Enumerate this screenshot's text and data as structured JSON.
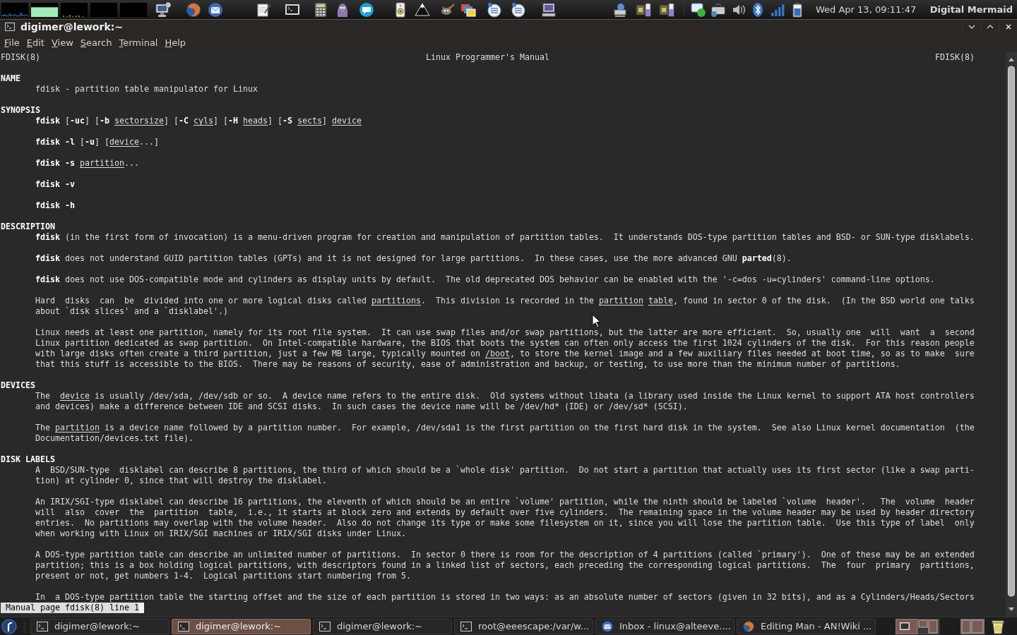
{
  "top_panel": {
    "clock": "Wed Apr 13, 09:11:47",
    "user_name": "Digital Mermaid"
  },
  "window": {
    "title": "digimer@lework:~",
    "menu": [
      "File",
      "Edit",
      "View",
      "Search",
      "Terminal",
      "Help"
    ]
  },
  "man_page": {
    "header": {
      "left": "FDISK(8)",
      "center": "Linux Programmer's Manual",
      "right": "FDISK(8)"
    },
    "sections": [
      {
        "heading": "NAME",
        "blocks": [
          {
            "kind": "paragraph",
            "lines": [
              "fdisk - partition table manipulator for Linux"
            ]
          }
        ]
      },
      {
        "heading": "SYNOPSIS",
        "blocks": [
          {
            "kind": "command",
            "command": "fdisk",
            "args": "[**-uc**] [**-b** *sectorsize*] [**-C** *cyls*] [**-H** *heads*] [**-S** *sects*] *device*"
          },
          {
            "kind": "command",
            "command": "fdisk -l",
            "args": "[**-u**] [*device*...]"
          },
          {
            "kind": "command",
            "command": "fdisk -s",
            "args": "*partition*..."
          },
          {
            "kind": "command",
            "command": "fdisk -v"
          },
          {
            "kind": "command",
            "command": "fdisk -h"
          }
        ]
      },
      {
        "heading": "DESCRIPTION",
        "blocks": [
          {
            "kind": "paragraph",
            "lines": [
              "**fdisk** (in the first form of invocation) is a menu-driven program for creation and manipulation of partition tables.  It understands DOS-type partition tables and BSD- or SUN-type disklabels."
            ]
          },
          {
            "kind": "paragraph",
            "lines": [
              "**fdisk** does not understand GUID partition tables (GPTs) and it is not designed for large partitions.  In these cases, use the more advanced GNU **parted**(8)."
            ]
          },
          {
            "kind": "paragraph",
            "lines": [
              "**fdisk** does not use DOS-compatible mode and cylinders as display units by default.  The old deprecated DOS behavior can be enabled with the '-c=dos -u=cylinders' command-line options."
            ]
          },
          {
            "kind": "paragraph",
            "lines": [
              "Hard  disks  can  be  divided into one or more logical disks called *partitions*.  This division is recorded in the *partition* *table*, found in sector 0 of the disk.  (In the BSD world one talks",
              "about `disk slices' and a `disklabel'.)"
            ]
          },
          {
            "kind": "paragraph",
            "lines": [
              "Linux needs at least one partition, namely for its root file system.  It can use swap files and/or swap partitions, but the latter are more efficient.  So, usually one  will  want  a  second",
              "Linux partition dedicated as swap partition.  On Intel-compatible hardware, the BIOS that boots the system can often only access the first 1024 cylinders of the disk.  For this reason people",
              "with large disks often create a third partition, just a few MB large, typically mounted on */boot*, to store the kernel image and a few auxiliary files needed at boot time, so as to make  sure",
              "that this stuff is accessible to the BIOS.  There may be reasons of security, ease of administration and backup, or testing, to use more than the minimum number of partitions."
            ]
          }
        ]
      },
      {
        "heading": "DEVICES",
        "blocks": [
          {
            "kind": "paragraph",
            "lines": [
              "The  *device* is usually /dev/sda, /dev/sdb or so.  A device name refers to the entire disk.  Old systems without libata (a library used inside the Linux kernel to support ATA host controllers",
              "and devices) make a difference between IDE and SCSI disks.  In such cases the device name will be /dev/hd* (IDE) or /dev/sd* (SCSI)."
            ]
          },
          {
            "kind": "paragraph",
            "lines": [
              "The *partition* is a device name followed by a partition number.  For example, /dev/sda1 is the first partition on the first hard disk in the system.  See also Linux kernel documentation  (the",
              "Documentation/devices.txt file)."
            ]
          }
        ]
      },
      {
        "heading": "DISK LABELS",
        "blocks": [
          {
            "kind": "paragraph",
            "lines": [
              "A  BSD/SUN-type  disklabel can describe 8 partitions, the third of which should be a `whole disk' partition.  Do not start a partition that actually uses its first sector (like a swap parti-",
              "tion) at cylinder 0, since that will destroy the disklabel."
            ]
          },
          {
            "kind": "paragraph",
            "lines": [
              "An IRIX/SGI-type disklabel can describe 16 partitions, the eleventh of which should be an entire `volume' partition, while the ninth should be labeled `volume  header'.   The  volume  header",
              "will  also  cover  the  partition  table,  i.e., it starts at block zero and extends by default over five cylinders.  The remaining space in the volume header may be used by header directory",
              "entries.  No partitions may overlap with the volume header.  Also do not change its type or make some filesystem on it, since you will lose the partition table.  Use this type of label  only",
              "when working with Linux on IRIX/SGI machines or IRIX/SGI disks under Linux."
            ]
          },
          {
            "kind": "paragraph",
            "lines": [
              "A DOS-type partition table can describe an unlimited number of partitions.  In sector 0 there is room for the description of 4 partitions (called `primary').  One of these may be an extended",
              "partition; this is a box holding logical partitions, with descriptors found in a linked list of sectors, each preceding the corresponding logical partitions.  The  four  primary  partitions,",
              "present or not, get numbers 1-4.  Logical partitions start numbering from 5."
            ]
          },
          {
            "kind": "paragraph",
            "lines": [
              "In  a DOS-type partition table the starting offset and the size of each partition is stored in two ways: as an absolute number of sectors (given in 32 bits), and as a Cylinders/Heads/Sectors"
            ]
          }
        ]
      }
    ],
    "status_line": "Manual page fdisk(8) line 1"
  },
  "taskbar": {
    "tasks": [
      {
        "label": "digimer@lework:~",
        "kind": "terminal",
        "selected": false
      },
      {
        "label": "digimer@lework:~",
        "kind": "terminal",
        "selected": true
      },
      {
        "label": "digimer@lework:~",
        "kind": "terminal",
        "selected": false
      },
      {
        "label": "root@eeescape:/var/w...",
        "kind": "terminal",
        "selected": false
      },
      {
        "label": "Inbox - linux@alteeve....",
        "kind": "mail",
        "selected": false
      },
      {
        "label": "Editing Man - AN!Wiki ...",
        "kind": "browser",
        "selected": false
      }
    ]
  }
}
